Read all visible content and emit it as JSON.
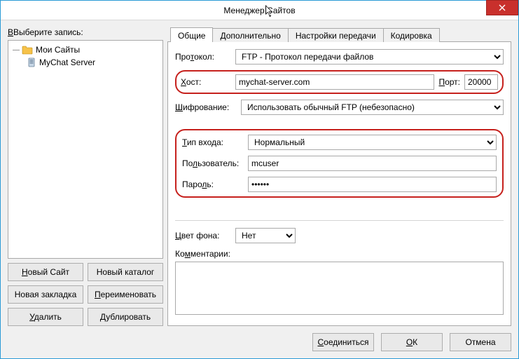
{
  "window": {
    "title": "Менеджер Сайтов"
  },
  "left": {
    "select_label": "Выберите запись:",
    "tree": {
      "root": "Мои Сайты",
      "child": "MyChat Server"
    },
    "buttons": {
      "new_site": "Новый Сайт",
      "new_folder": "Новый каталог",
      "new_bookmark": "Новая закладка",
      "rename": "Переименовать",
      "delete": "Удалить",
      "duplicate": "Дублировать"
    }
  },
  "tabs": {
    "general": "Общие",
    "advanced": "Дополнительно",
    "transfer": "Настройки передачи",
    "charset": "Кодировка"
  },
  "form": {
    "protocol_label": "Протокол:",
    "protocol_value": "FTP - Протокол передачи файлов",
    "host_label": "Хост:",
    "host_value": "mychat-server.com",
    "port_label": "Порт:",
    "port_value": "20000",
    "encryption_label": "Шифрование:",
    "encryption_value": "Использовать обычный FTP (небезопасно)",
    "logon_type_label": "Тип входа:",
    "logon_type_value": "Нормальный",
    "user_label": "Пользователь:",
    "user_value": "mcuser",
    "password_label": "Пароль:",
    "password_value": "••••••",
    "bgcolor_label": "Цвет фона:",
    "bgcolor_value": "Нет",
    "comments_label": "Комментарии:",
    "comments_value": ""
  },
  "footer": {
    "connect": "Соединиться",
    "ok": "ОК",
    "cancel": "Отмена"
  }
}
